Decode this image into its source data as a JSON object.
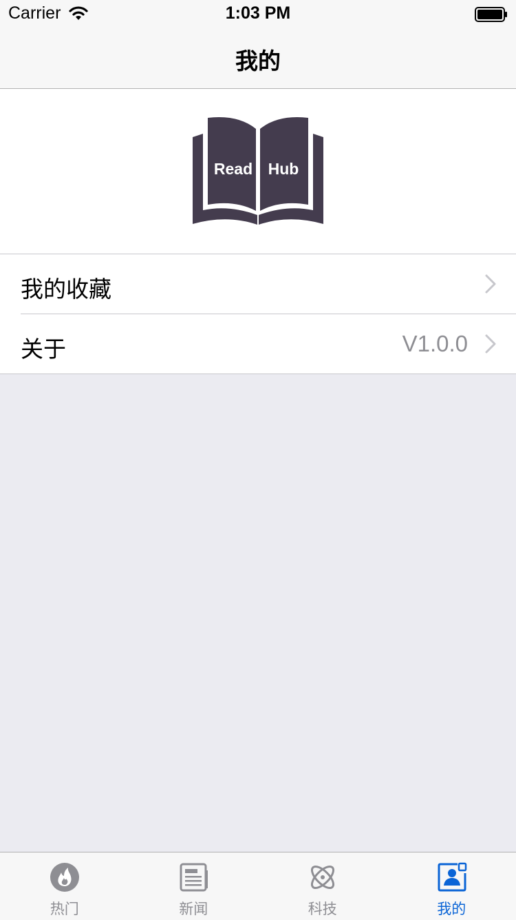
{
  "status_bar": {
    "carrier": "Carrier",
    "time": "1:03 PM",
    "wifi_icon": "wifi-icon",
    "battery_icon": "battery-icon"
  },
  "nav": {
    "title": "我的"
  },
  "header": {
    "logo_left": "Read",
    "logo_right": "Hub",
    "logo_color": "#443c4e"
  },
  "cells": {
    "favorites": {
      "label": "我的收藏",
      "chevron_icon": "chevron-right-icon"
    },
    "about": {
      "label": "关于",
      "detail": "V1.0.0",
      "chevron_icon": "chevron-right-icon"
    }
  },
  "tabbar": {
    "active_color": "#0a64d6",
    "inactive_color": "#8e8e93",
    "tabs": [
      {
        "label": "热门",
        "icon": "fire-icon",
        "active": false
      },
      {
        "label": "新闻",
        "icon": "newspaper-icon",
        "active": false
      },
      {
        "label": "科技",
        "icon": "atom-icon",
        "active": false
      },
      {
        "label": "我的",
        "icon": "profile-card-icon",
        "active": true
      }
    ]
  }
}
